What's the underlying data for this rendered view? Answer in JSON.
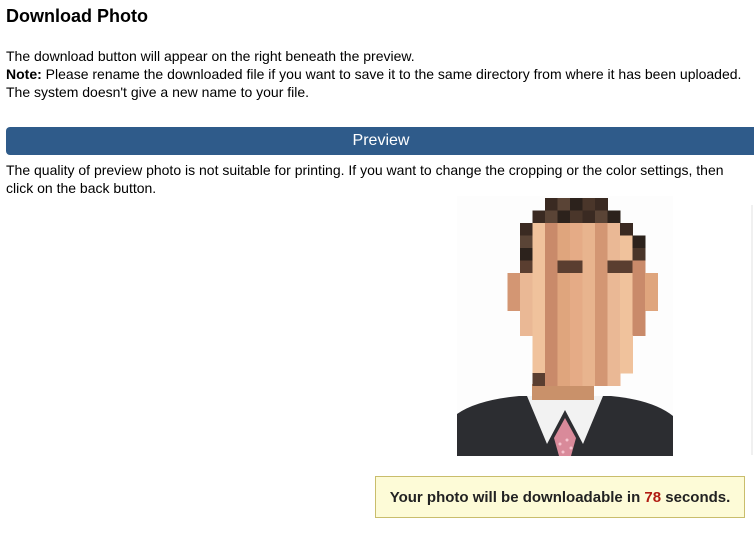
{
  "page": {
    "title": "Download Photo",
    "intro_line1": "The download button will appear on the right beneath the preview.",
    "note_label": "Note:",
    "note_text": " Please rename the downloaded file if you want to save it to the same directory from where it has been uploaded. The system doesn't give a new name to your file."
  },
  "preview": {
    "bar_label": "Preview",
    "quality_text": "The quality of preview photo is not suitable for printing. If you want to change the cropping or the color settings, then click on the back button."
  },
  "countdown": {
    "prefix": "Your photo will be downloadable in ",
    "seconds": "78",
    "suffix": " seconds."
  },
  "colors": {
    "preview_bar": "#2f5b8a",
    "countdown_bg": "#fdfbd7",
    "countdown_border": "#c9bd6c",
    "countdown_number": "#b11c12"
  }
}
